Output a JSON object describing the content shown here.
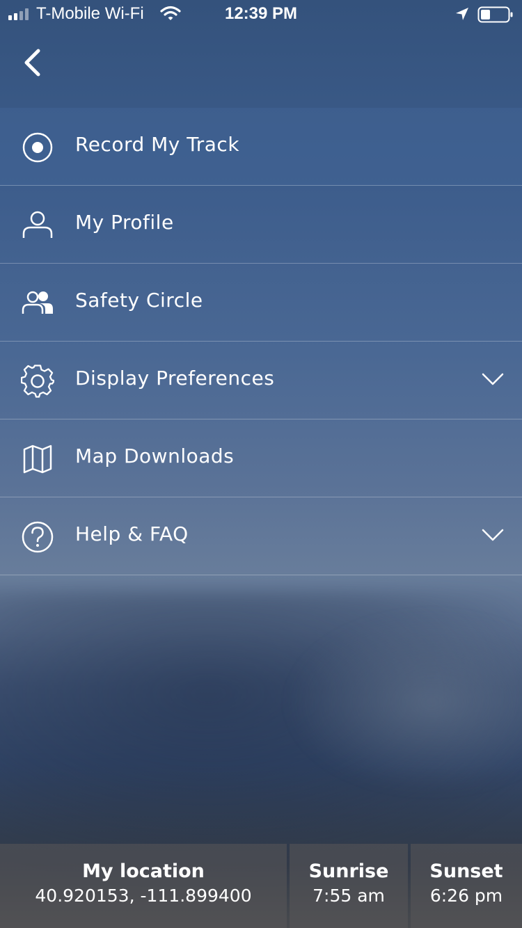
{
  "status_bar": {
    "carrier": "T-Mobile Wi-Fi",
    "time": "12:39 PM",
    "icons": [
      "signal-icon",
      "wifi-icon",
      "location-arrow-icon",
      "battery-icon"
    ]
  },
  "header": {
    "back_icon": "chevron-left-icon"
  },
  "menu": {
    "items": [
      {
        "label": "Record My Track",
        "icon": "record-icon",
        "expandable": false
      },
      {
        "label": "My Profile",
        "icon": "user-icon",
        "expandable": false
      },
      {
        "label": "Safety Circle",
        "icon": "group-icon",
        "expandable": false
      },
      {
        "label": "Display Preferences",
        "icon": "gear-icon",
        "expandable": true
      },
      {
        "label": "Map Downloads",
        "icon": "map-icon",
        "expandable": false
      },
      {
        "label": "Help & FAQ",
        "icon": "help-icon",
        "expandable": true
      }
    ]
  },
  "info_bar": {
    "location_title": "My location",
    "location_value": "40.920153, -111.899400",
    "sunrise_title": "Sunrise",
    "sunrise_value": "7:55 am",
    "sunset_title": "Sunset",
    "sunset_value": "6:26 pm"
  },
  "colors": {
    "text": "#ffffff",
    "active_row": "#42649a"
  }
}
